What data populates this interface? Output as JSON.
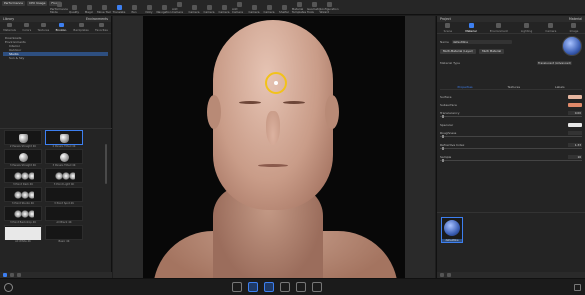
{
  "toolbar": {
    "fields": [
      "Performance",
      "CPU Usage",
      "Floor"
    ],
    "buttons": [
      {
        "label": "Performance Mode",
        "active": false
      },
      {
        "label": "Quality",
        "active": false
      },
      {
        "label": "Magic",
        "active": false
      },
      {
        "label": "Move Tool",
        "active": false
      },
      {
        "label": "Translate",
        "active": true
      },
      {
        "label": "Pan",
        "active": false
      },
      {
        "label": "Dolly",
        "active": false
      },
      {
        "label": "Navigation",
        "active": false
      },
      {
        "label": "Add Camera",
        "active": false
      },
      {
        "label": "Camera",
        "active": false
      },
      {
        "label": "Camera",
        "active": false
      },
      {
        "label": "Camera",
        "active": false
      },
      {
        "label": "Add Camera",
        "active": false
      },
      {
        "label": "Camera",
        "active": false
      },
      {
        "label": "Camera",
        "active": false
      },
      {
        "label": "Shelfer",
        "active": false
      },
      {
        "label": "Material Templates",
        "active": false
      },
      {
        "label": "Geometry Tools",
        "active": false
      },
      {
        "label": "Configuration Wizard",
        "active": false
      }
    ]
  },
  "left_panel": {
    "header_left": "Library",
    "header_right": "Environments",
    "tabs": [
      {
        "label": "Materials",
        "active": false
      },
      {
        "label": "Colors",
        "active": false
      },
      {
        "label": "Textures",
        "active": false
      },
      {
        "label": "Environ.",
        "active": true
      },
      {
        "label": "Backplates",
        "active": false
      },
      {
        "label": "Favorites",
        "active": false
      }
    ],
    "tree": [
      {
        "label": "Downloads",
        "level": 0,
        "selected": false
      },
      {
        "label": "Environments",
        "level": 0,
        "selected": false
      },
      {
        "label": "Interior",
        "level": 1,
        "selected": false
      },
      {
        "label": "Outdoor",
        "level": 1,
        "selected": false
      },
      {
        "label": "Studio",
        "level": 1,
        "selected": true
      },
      {
        "label": "Sun & Sky",
        "level": 1,
        "selected": false
      }
    ],
    "thumbnails": [
      {
        "caption": "2 Panels Straight 4K",
        "kind": "cyl",
        "selected": false
      },
      {
        "caption": "2 Panels Tilted 4K",
        "kind": "cyl",
        "selected": true
      },
      {
        "caption": "3 Panels Straight 4K",
        "kind": "ball",
        "selected": false
      },
      {
        "caption": "3 Panels Tilted 4K",
        "kind": "ball",
        "selected": false
      },
      {
        "caption": "3 Point Dark 4K",
        "kind": "trio",
        "selected": false
      },
      {
        "caption": "3 Point Light 4K",
        "kind": "trio",
        "selected": false
      },
      {
        "caption": "3 Point Studio 4K",
        "kind": "trio",
        "selected": false
      },
      {
        "caption": "3 Point Spot 4K",
        "kind": "dark",
        "selected": false
      },
      {
        "caption": "3 Point Backdrop 4K",
        "kind": "trio",
        "selected": false
      },
      {
        "caption": "All Black 4K",
        "kind": "dark",
        "selected": false
      },
      {
        "caption": "All White 4K",
        "kind": "white",
        "selected": false
      },
      {
        "caption": "Basic 4K",
        "kind": "dark",
        "selected": false
      }
    ]
  },
  "right_panel": {
    "header_left": "Project",
    "header_right": "Material",
    "tabs": [
      {
        "label": "Scene",
        "active": false
      },
      {
        "label": "Material",
        "active": true
      },
      {
        "label": "Environment",
        "active": false
      },
      {
        "label": "Lighting",
        "active": false
      },
      {
        "label": "Camera",
        "active": false
      },
      {
        "label": "Image",
        "active": false
      }
    ],
    "name_label": "Name",
    "name_value": "default0ne",
    "buttons": [
      "Multi-Material (Layer)",
      "Multi Material"
    ],
    "type_label": "Material Type",
    "type_value": "Translucent (Advanced)",
    "subtabs": [
      {
        "label": "Properties",
        "active": true
      },
      {
        "label": "Textures",
        "active": false
      },
      {
        "label": "Labels",
        "active": false
      }
    ],
    "properties": [
      {
        "label": "Surface",
        "color": "#e6b6a0"
      },
      {
        "label": "Subsurface",
        "color": "#e0896a"
      },
      {
        "label": "Translucency",
        "value": "0.00"
      },
      {
        "label": "Specular",
        "color": "#e8e8e8"
      },
      {
        "label": "Roughness",
        "value": ""
      },
      {
        "label": "Refractive Index",
        "value": "1.33"
      },
      {
        "label": "Sample",
        "value": "16"
      }
    ],
    "material_thumb": "default0ne"
  },
  "colors": {
    "accent": "#3d7ff0",
    "gizmo": "#f2c21a"
  }
}
